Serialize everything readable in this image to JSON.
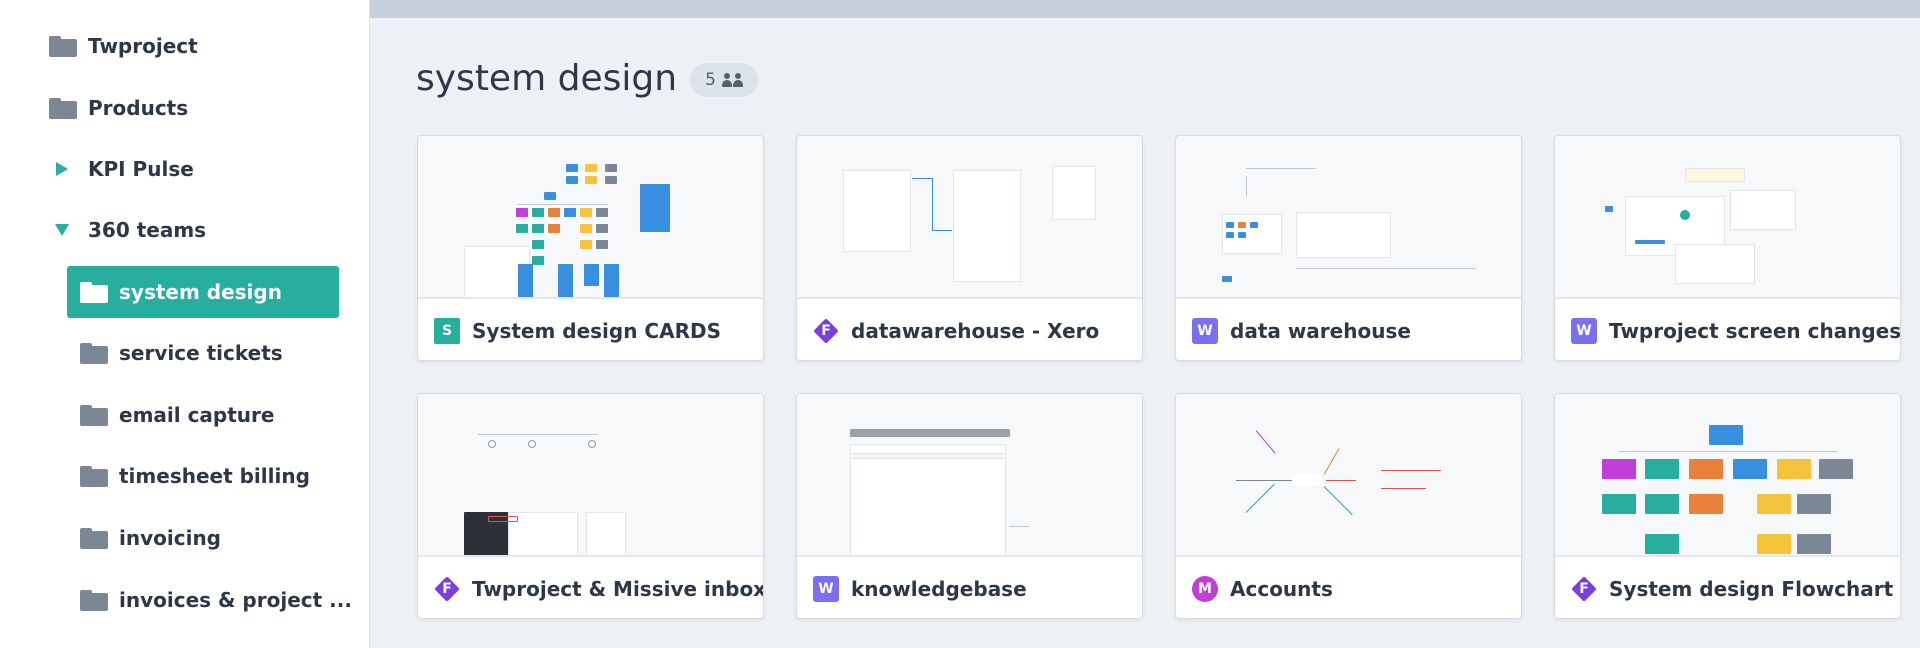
{
  "sidebar": {
    "items": [
      {
        "label": "Twproject",
        "icon": "folder-icon"
      },
      {
        "label": "Products",
        "icon": "folder-icon"
      },
      {
        "label": "KPI Pulse",
        "icon": "caret-right-icon"
      },
      {
        "label": "360 teams",
        "icon": "caret-down-icon"
      },
      {
        "label": "system design",
        "icon": "folder-icon",
        "selected": true
      },
      {
        "label": "service tickets",
        "icon": "folder-icon"
      },
      {
        "label": "email capture",
        "icon": "folder-icon"
      },
      {
        "label": "timesheet billing",
        "icon": "folder-icon"
      },
      {
        "label": "invoicing",
        "icon": "folder-icon"
      },
      {
        "label": "invoices & project ...",
        "icon": "folder-icon"
      }
    ]
  },
  "header": {
    "title": "system design",
    "member_count": "5"
  },
  "colors": {
    "accent": "#27ae9f",
    "sheet": "#27ae9f",
    "whiteboard": "#7b6ef0",
    "mindmap": "#c03fd6",
    "flowchart": "#7b3fe0"
  },
  "cards": [
    {
      "type_letter": "S",
      "name": "System design CARDS"
    },
    {
      "type_letter": "F",
      "name": "datawarehouse - Xero"
    },
    {
      "type_letter": "W",
      "name": "data warehouse"
    },
    {
      "type_letter": "W",
      "name": "Twproject screen changes"
    },
    {
      "type_letter": "F",
      "name": "Twproject & Missive inbox"
    },
    {
      "type_letter": "W",
      "name": "knowledgebase"
    },
    {
      "type_letter": "M",
      "name": "Accounts"
    },
    {
      "type_letter": "F",
      "name": "System design Flowchart"
    }
  ]
}
